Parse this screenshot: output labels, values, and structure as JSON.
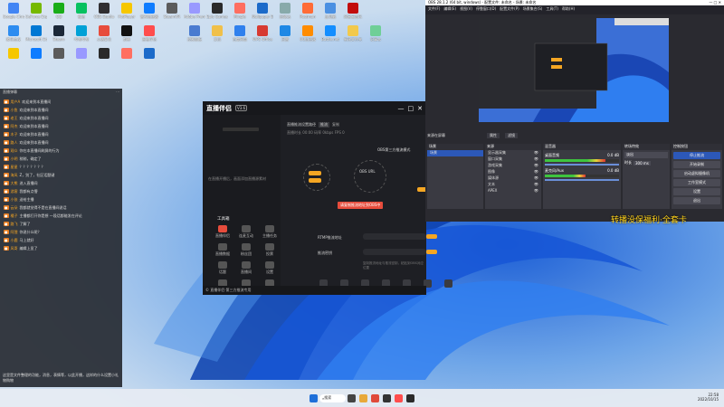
{
  "desktop": {
    "icons": [
      "Google Chrome",
      "GeForce Experience",
      "QQ",
      "微信",
      "OBS Studio",
      "PotPlayer",
      "雷神加速器",
      "SteamVR",
      "Adobe Premiere",
      "Epic Games",
      "Mingle",
      "Wallpaper Engine",
      "回收站",
      "Postman",
      "此电脑",
      "网易云音乐",
      "腾讯会议",
      "Microsoft Edge",
      "Steam",
      "哔哩哔哩",
      "火绒安全",
      "剪映",
      "直播伴侣",
      "控制面板",
      "文档",
      "百度网盘",
      "WPS Office",
      "迅雷",
      "UU加速器",
      "Battle.net",
      "新建文件夹",
      "记事本"
    ]
  },
  "chat": {
    "title": "直播弹幕",
    "lines": [
      {
        "name": "用户A",
        "text": "欢迎来到本直播间"
      },
      {
        "name": "小鱼",
        "text": "欢迎来到本直播间"
      },
      {
        "name": "老王",
        "text": "欢迎来到本直播间"
      },
      {
        "name": "阿杰",
        "text": "欢迎来到本直播间"
      },
      {
        "name": "木子",
        "text": "欢迎来到本直播间"
      },
      {
        "name": "路人",
        "text": "欢迎来到本直播间"
      },
      {
        "name": "观众",
        "text": "你在本直播间刷屏的行为"
      },
      {
        "name": "小明",
        "text": "稍稍，确定了"
      },
      {
        "name": "星星",
        "text": "？？？？？？？"
      },
      {
        "name": "海风",
        "text": "Z，别了，社区话题键"
      },
      {
        "name": "大熊",
        "text": "进入直播间"
      },
      {
        "name": "游客",
        "text": "我都有点懵"
      },
      {
        "name": "小张",
        "text": "送给主播"
      },
      {
        "name": "云朵",
        "text": "我都就觉得不是在直播间说话"
      },
      {
        "name": "橘子",
        "text": "主播都打开你是想 一段话都能发在评论"
      },
      {
        "name": "路飞",
        "text": "了解了"
      },
      {
        "name": "阿狸",
        "text": "你说什么呢？"
      },
      {
        "name": "小鹿",
        "text": "马上就好"
      },
      {
        "name": "风哥",
        "text": "编辑上显了"
      }
    ],
    "footer": "这里是文件整理的功能，消息，表情等，以此开播，这样的什么设置小礼物购物"
  },
  "live_app": {
    "logo": "直播伴侣",
    "version": "V3.6",
    "sidebar_hint": "在直播开播后，画面添加直播源素材",
    "tools_title": "工具箱",
    "tools": [
      "直播伴侣",
      "连麦互动",
      "主播任务",
      "直播数据",
      "粉丝团",
      "投票",
      "话题",
      "直播间",
      "设置",
      "福袋",
      "抽奖",
      "更多"
    ],
    "path_label": "直播推流设置路径",
    "path_btn": "推流",
    "path_copy": "复制",
    "stats": "直播时长 00:00  码率 0kbps  FPS 0",
    "obs_title": "OBS第三方推流模式",
    "obs_node": "OBS URL",
    "tip": "请复制推流地址到OBS中",
    "rtmp_label": "RTMP推流地址",
    "key_label": "推流密钥",
    "note": "复制推流地址与推流密钥，粘贴到OBS对应位置",
    "bottom_note": "© 直播伴侣·第三方推流专用"
  },
  "obs": {
    "title": "OBS 28.1.2 (64 bit, windows) - 配置文件: 未命名 - 场景: 未命名",
    "menu": [
      "文件(F)",
      "编辑(E)",
      "视图(V)",
      "停靠窗口(D)",
      "配置文件(P)",
      "场景集合(S)",
      "工具(T)",
      "帮助(H)"
    ],
    "docks": {
      "scenes": "场景",
      "sources": "来源",
      "mixer": "混音器",
      "transitions": "转场特效",
      "controls": "控制按钮"
    },
    "scene_items": [
      "场景"
    ],
    "source_items": [
      "显示器采集",
      "窗口采集",
      "游戏采集",
      "图像",
      "媒体源",
      "文本",
      "APEX"
    ],
    "mixer_items": [
      {
        "name": "桌面音频",
        "db": "0.0 dB",
        "level": 0.82
      },
      {
        "name": "麦克风/Aux",
        "db": "0.0 dB",
        "level": 0.55
      }
    ],
    "transition": "淡出",
    "duration_label": "时长",
    "duration": "300 ms",
    "controls": [
      "停止推流",
      "开始录制",
      "启动虚拟摄像机",
      "工作室模式",
      "设置",
      "退出"
    ],
    "preview_label": "来源在屏幕",
    "props_btn": "属性",
    "filters_btn": "滤镜"
  },
  "watermark": "转播没保福利·全套卡",
  "taskbar": {
    "search": "搜索",
    "time": "22:58",
    "date": "2022/10/15"
  }
}
